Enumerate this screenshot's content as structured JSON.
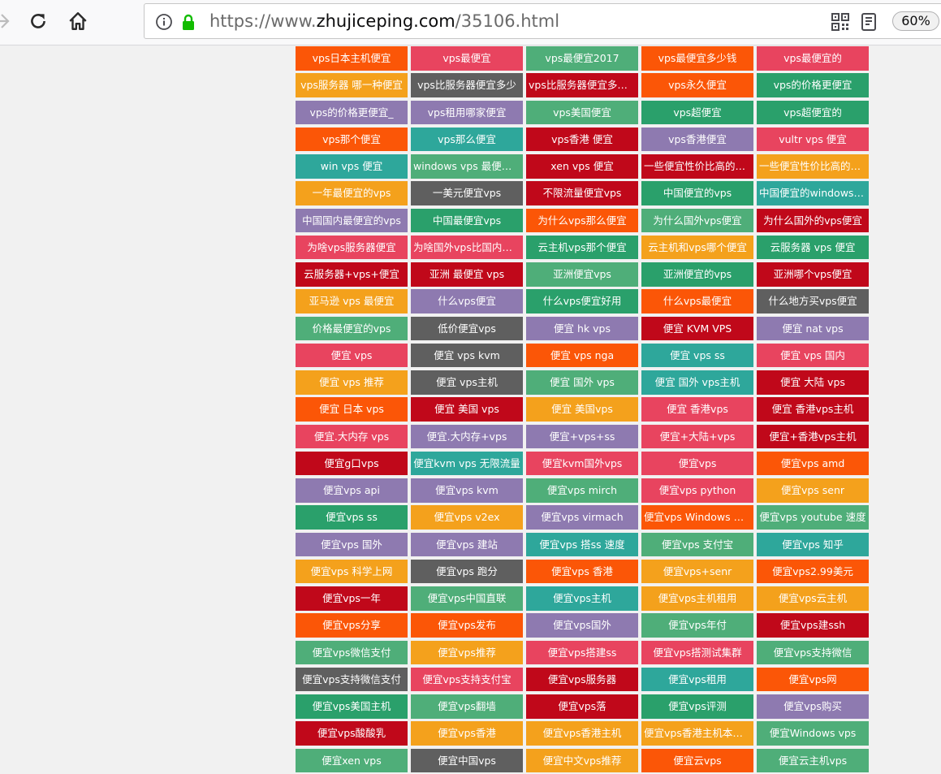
{
  "browser": {
    "url_prefix": "https://www.",
    "url_host": "zhujiceping.com",
    "url_path": "/35106.html",
    "zoom": "60%",
    "icons": [
      "back-icon",
      "reload-icon",
      "home-icon",
      "info-icon",
      "lock-icon",
      "qr-code-icon",
      "reader-view-icon"
    ],
    "lock_color": "#12bc00"
  },
  "palette": {
    "o": "#fb5607",
    "r": "#e8445f",
    "g": "#4fae79",
    "dr": "#c0081a",
    "tl": "#2ea79b",
    "y": "#f4a11c",
    "gy": "#5f5f5f",
    "p": "#8e7ab0",
    "gr": "#2aa06b"
  },
  "tags": [
    {
      "t": "vps日本主机便宜",
      "c": "o"
    },
    {
      "t": "vps最便宜",
      "c": "r"
    },
    {
      "t": "vps最便宜2017",
      "c": "g"
    },
    {
      "t": "vps最便宜多少钱",
      "c": "o"
    },
    {
      "t": "vps最便宜的",
      "c": "r"
    },
    {
      "t": "vps服务器 哪一种便宜",
      "c": "y"
    },
    {
      "t": "vps比服务器便宜多少",
      "c": "gy"
    },
    {
      "t": "vps比服务器便宜多少钱",
      "c": "dr"
    },
    {
      "t": "vps永久便宜",
      "c": "o"
    },
    {
      "t": "vps的价格更便宜",
      "c": "gr"
    },
    {
      "t": "vps的价格更便宜_",
      "c": "p"
    },
    {
      "t": "vps租用哪家便宜",
      "c": "p"
    },
    {
      "t": "vps美国便宜",
      "c": "g"
    },
    {
      "t": "vps超便宜",
      "c": "gr"
    },
    {
      "t": "vps超便宜的",
      "c": "gr"
    },
    {
      "t": "vps那个便宜",
      "c": "o"
    },
    {
      "t": "vps那么便宜",
      "c": "tl"
    },
    {
      "t": "vps香港 便宜",
      "c": "dr"
    },
    {
      "t": "vps香港便宜",
      "c": "p"
    },
    {
      "t": "vultr vps 便宜",
      "c": "r"
    },
    {
      "t": "win vps 便宜",
      "c": "tl"
    },
    {
      "t": "windows vps 最便宜的",
      "c": "g"
    },
    {
      "t": "xen vps 便宜",
      "c": "dr"
    },
    {
      "t": "一些便宜性价比高的vps",
      "c": "dr"
    },
    {
      "t": "一些便宜性价比高的vps",
      "c": "y"
    },
    {
      "t": "一年最便宜的vps",
      "c": "y"
    },
    {
      "t": "一美元便宜vps",
      "c": "gy"
    },
    {
      "t": "不限流量便宜vps",
      "c": "dr"
    },
    {
      "t": "中国便宜的vps",
      "c": "gr"
    },
    {
      "t": "中国便宜的windows vps",
      "c": "tl"
    },
    {
      "t": "中国国内最便宜的vps",
      "c": "p"
    },
    {
      "t": "中国最便宜vps",
      "c": "gr"
    },
    {
      "t": "为什么vps那么便宜",
      "c": "o"
    },
    {
      "t": "为什么国外vps便宜",
      "c": "g"
    },
    {
      "t": "为什么国外的vps便宜",
      "c": "dr"
    },
    {
      "t": "为啥vps服务器便宜",
      "c": "r"
    },
    {
      "t": "为啥国外vps比国内便宜",
      "c": "r"
    },
    {
      "t": "云主机vps那个便宜",
      "c": "gr"
    },
    {
      "t": "云主机和vps哪个便宜",
      "c": "y"
    },
    {
      "t": "云服务器 vps 便宜",
      "c": "gr"
    },
    {
      "t": "云服务器+vps+便宜",
      "c": "dr"
    },
    {
      "t": "亚洲 最便宜 vps",
      "c": "dr"
    },
    {
      "t": "亚洲便宜vps",
      "c": "g"
    },
    {
      "t": "亚洲便宜的vps",
      "c": "gr"
    },
    {
      "t": "亚洲哪个vps便宜",
      "c": "dr"
    },
    {
      "t": "亚马逊 vps 最便宜",
      "c": "y"
    },
    {
      "t": "什么vps便宜",
      "c": "p"
    },
    {
      "t": "什么vps便宜好用",
      "c": "gr"
    },
    {
      "t": "什么vps最便宜",
      "c": "o"
    },
    {
      "t": "什么地方买vps便宜",
      "c": "gy"
    },
    {
      "t": "价格最便宜的vps",
      "c": "g"
    },
    {
      "t": "低价便宜vps",
      "c": "gy"
    },
    {
      "t": "便宜 hk vps",
      "c": "p"
    },
    {
      "t": "便宜 KVM VPS",
      "c": "dr"
    },
    {
      "t": "便宜 nat vps",
      "c": "p"
    },
    {
      "t": "便宜 vps",
      "c": "r"
    },
    {
      "t": "便宜 vps kvm",
      "c": "gy"
    },
    {
      "t": "便宜 vps nga",
      "c": "o"
    },
    {
      "t": "便宜 vps ss",
      "c": "tl"
    },
    {
      "t": "便宜 vps 国内",
      "c": "r"
    },
    {
      "t": "便宜 vps 推荐",
      "c": "y"
    },
    {
      "t": "便宜 vps主机",
      "c": "gy"
    },
    {
      "t": "便宜 国外 vps",
      "c": "g"
    },
    {
      "t": "便宜 国外 vps主机",
      "c": "tl"
    },
    {
      "t": "便宜 大陆 vps",
      "c": "dr"
    },
    {
      "t": "便宜 日本 vps",
      "c": "o"
    },
    {
      "t": "便宜 美国 vps",
      "c": "dr"
    },
    {
      "t": "便宜 美国vps",
      "c": "y"
    },
    {
      "t": "便宜 香港vps",
      "c": "r"
    },
    {
      "t": "便宜 香港vps主机",
      "c": "dr"
    },
    {
      "t": "便宜.大内存 vps",
      "c": "r"
    },
    {
      "t": "便宜.大内存+vps",
      "c": "p"
    },
    {
      "t": "便宜+vps+ss",
      "c": "p"
    },
    {
      "t": "便宜+大陆+vps",
      "c": "r"
    },
    {
      "t": "便宜+香港vps主机",
      "c": "dr"
    },
    {
      "t": "便宜g口vps",
      "c": "dr"
    },
    {
      "t": "便宜kvm vps 无限流量",
      "c": "tl"
    },
    {
      "t": "便宜kvm国外vps",
      "c": "r"
    },
    {
      "t": "便宜vps",
      "c": "r"
    },
    {
      "t": "便宜vps amd",
      "c": "o"
    },
    {
      "t": "便宜vps api",
      "c": "p"
    },
    {
      "t": "便宜vps kvm",
      "c": "p"
    },
    {
      "t": "便宜vps mirch",
      "c": "g"
    },
    {
      "t": "便宜vps python",
      "c": "r"
    },
    {
      "t": "便宜vps senr",
      "c": "y"
    },
    {
      "t": "便宜vps ss",
      "c": "gr"
    },
    {
      "t": "便宜vps v2ex",
      "c": "y"
    },
    {
      "t": "便宜vps virmach",
      "c": "p"
    },
    {
      "t": "便宜vps Windows 日本",
      "c": "o"
    },
    {
      "t": "便宜vps youtube 速度",
      "c": "g"
    },
    {
      "t": "便宜vps 国外",
      "c": "p"
    },
    {
      "t": "便宜vps 建站",
      "c": "p"
    },
    {
      "t": "便宜vps 搭ss 速度",
      "c": "tl"
    },
    {
      "t": "便宜vps 支付宝",
      "c": "g"
    },
    {
      "t": "便宜vps 知乎",
      "c": "tl"
    },
    {
      "t": "便宜vps 科学上网",
      "c": "y"
    },
    {
      "t": "便宜vps 跑分",
      "c": "gy"
    },
    {
      "t": "便宜vps 香港",
      "c": "o"
    },
    {
      "t": "便宜vps+senr",
      "c": "y"
    },
    {
      "t": "便宜vps2.99美元",
      "c": "o"
    },
    {
      "t": "便宜vps一年",
      "c": "dr"
    },
    {
      "t": "便宜vps中国直联",
      "c": "g"
    },
    {
      "t": "便宜vps主机",
      "c": "tl"
    },
    {
      "t": "便宜vps主机租用",
      "c": "y"
    },
    {
      "t": "便宜vps云主机",
      "c": "y"
    },
    {
      "t": "便宜vps分享",
      "c": "o"
    },
    {
      "t": "便宜vps发布",
      "c": "o"
    },
    {
      "t": "便宜vps国外",
      "c": "p"
    },
    {
      "t": "便宜vps年付",
      "c": "g"
    },
    {
      "t": "便宜vps建ssh",
      "c": "dr"
    },
    {
      "t": "便宜vps微信支付",
      "c": "g"
    },
    {
      "t": "便宜vps推荐",
      "c": "y"
    },
    {
      "t": "便宜vps搭建ss",
      "c": "r"
    },
    {
      "t": "便宜vps搭测试集群",
      "c": "r"
    },
    {
      "t": "便宜vps支持微信",
      "c": "g"
    },
    {
      "t": "便宜vps支持微信支付",
      "c": "gy"
    },
    {
      "t": "便宜vps支持支付宝",
      "c": "r"
    },
    {
      "t": "便宜vps服务器",
      "c": "dr"
    },
    {
      "t": "便宜vps租用",
      "c": "tl"
    },
    {
      "t": "便宜vps网",
      "c": "o"
    },
    {
      "t": "便宜vps美国主机",
      "c": "gr"
    },
    {
      "t": "便宜vps翻墙",
      "c": "g"
    },
    {
      "t": "便宜vps落",
      "c": "dr"
    },
    {
      "t": "便宜vps评测",
      "c": "gr"
    },
    {
      "t": "便宜vps购买",
      "c": "p"
    },
    {
      "t": "便宜vps酸酸乳",
      "c": "dr"
    },
    {
      "t": "便宜vps香港",
      "c": "y"
    },
    {
      "t": "便宜vps香港主机",
      "c": "y"
    },
    {
      "t": "便宜vps香港主机本地测试",
      "c": "y"
    },
    {
      "t": "便宜Windows vps",
      "c": "g"
    },
    {
      "t": "便宜xen vps",
      "c": "g"
    },
    {
      "t": "便宜中国vps",
      "c": "gy"
    },
    {
      "t": "便宜中文vps推荐",
      "c": "y"
    },
    {
      "t": "便宜云vps",
      "c": "o"
    },
    {
      "t": "便宜云主机vps",
      "c": "g"
    }
  ]
}
